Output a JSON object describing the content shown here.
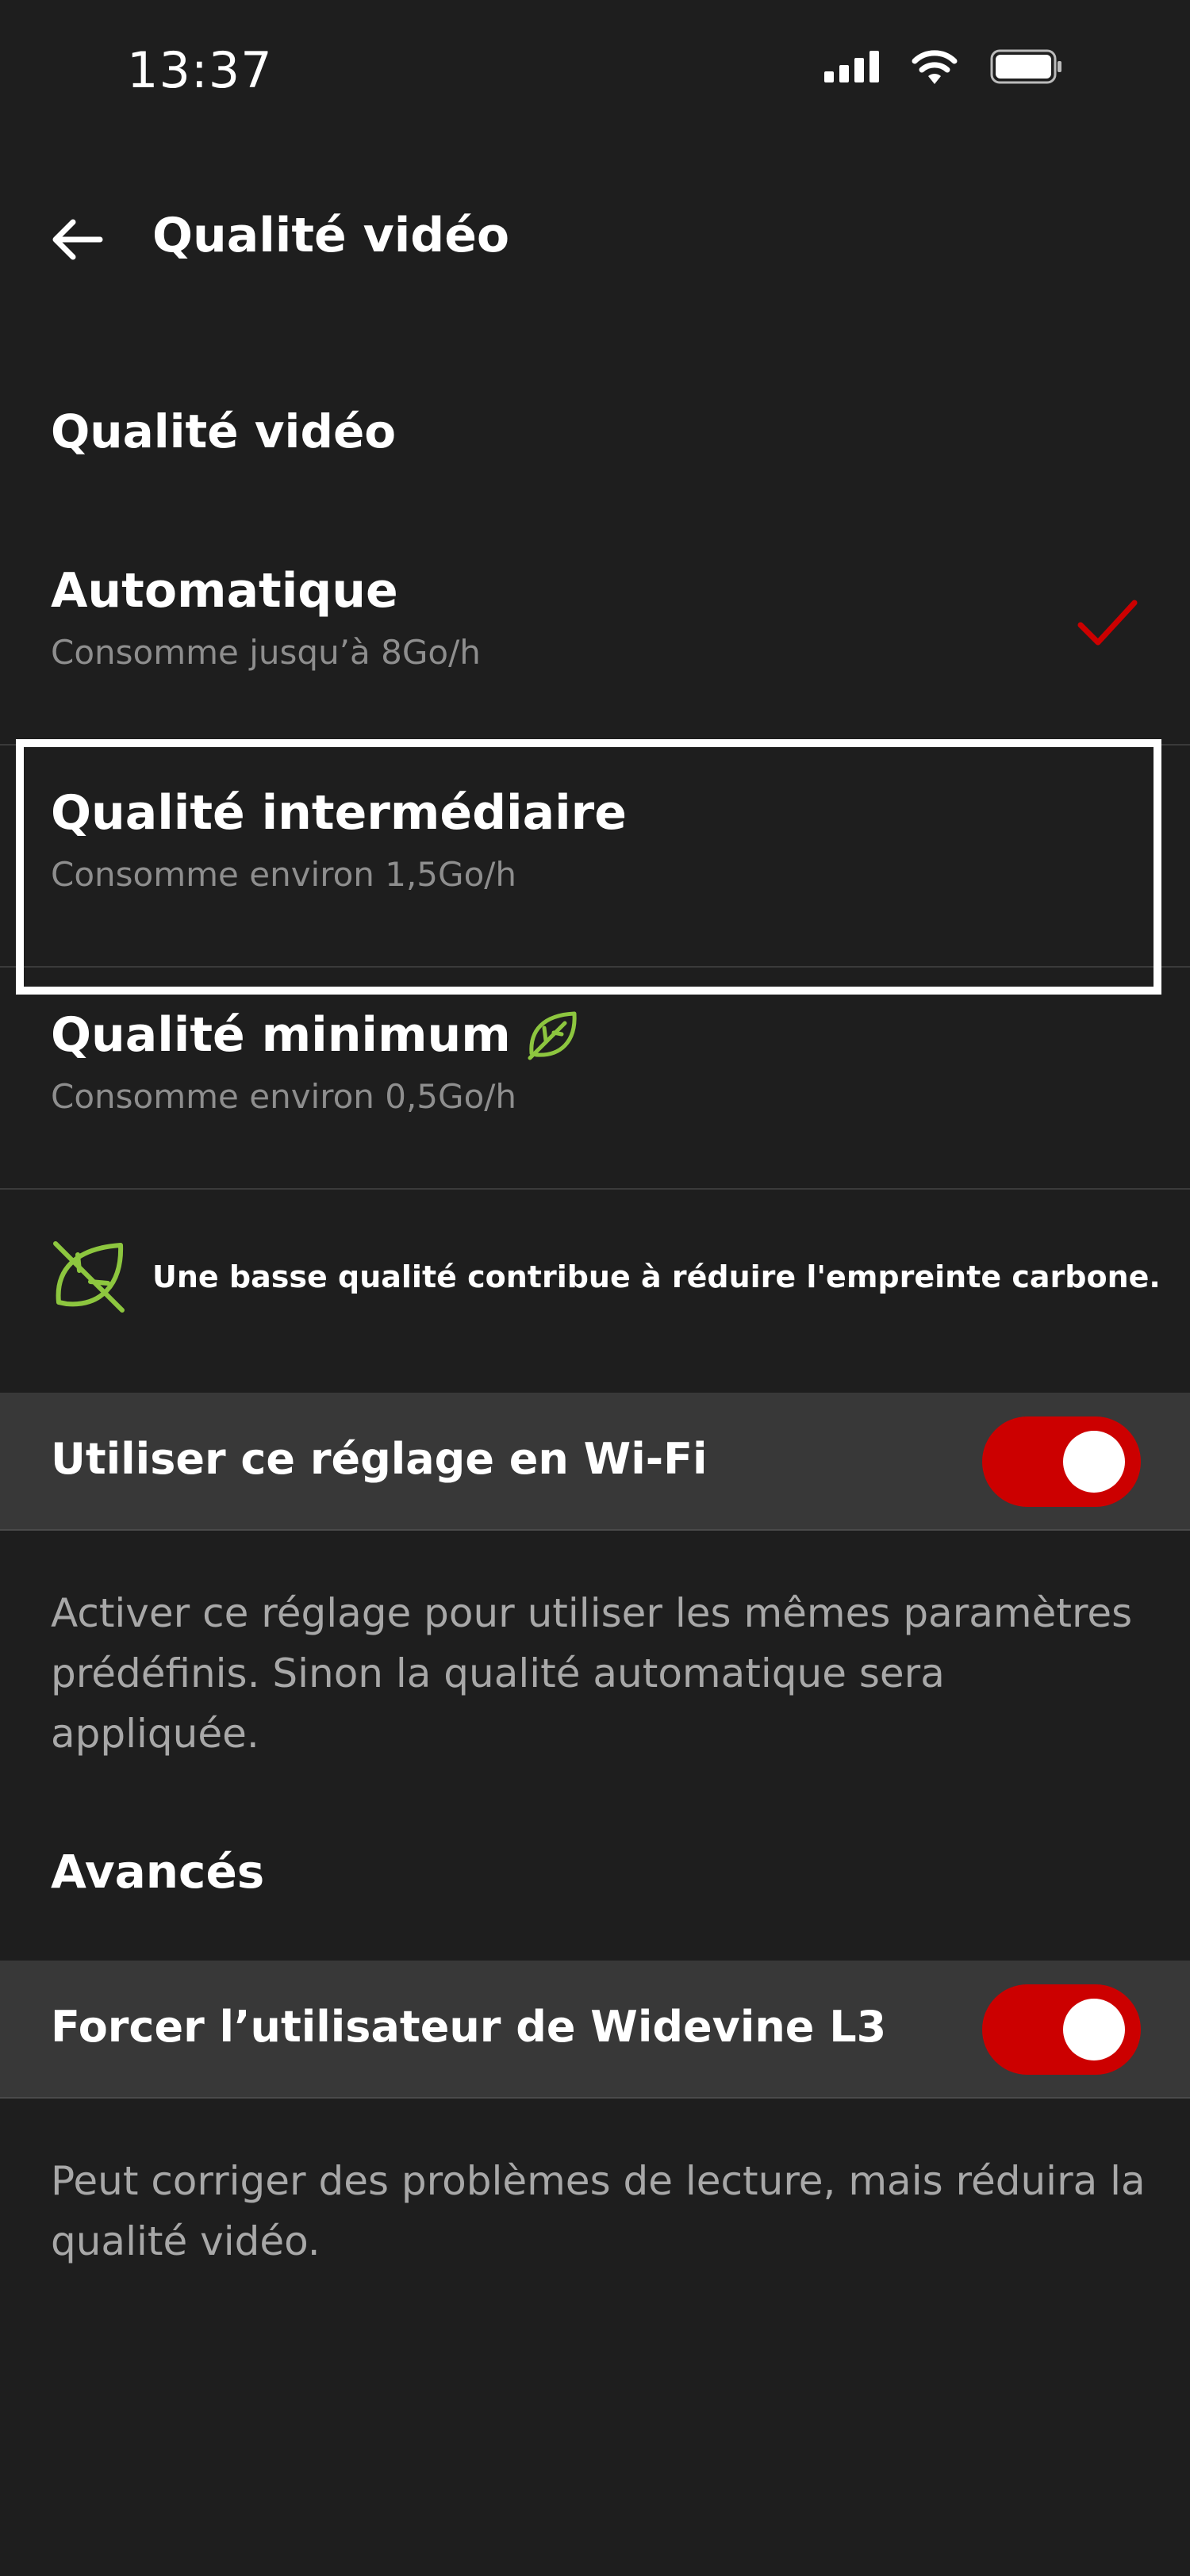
{
  "status_bar": {
    "time": "13:37"
  },
  "header": {
    "title": "Qualité vidéo",
    "back_icon": "arrow-left-icon"
  },
  "quality_section": {
    "title": "Qualité vidéo",
    "options": [
      {
        "title": "Automatique",
        "subtitle": "Consomme jusqu’à 8Go/h",
        "selected": true
      },
      {
        "title": "Qualité intermédiaire",
        "subtitle": "Consomme environ 1,5Go/h",
        "selected": false
      },
      {
        "title": "Qualité minimum",
        "subtitle": "Consomme environ 0,5Go/h",
        "selected": false
      }
    ]
  },
  "eco_note": {
    "text": "Une basse qualité contribue à réduire l'empreinte carbone.",
    "icon": "leaf-icon"
  },
  "wifi_setting": {
    "label": "Utiliser ce réglage en Wi-Fi",
    "enabled": true,
    "description": "Activer ce réglage pour utiliser les mêmes paramètres prédéfinis. Sinon la qualité automatique sera appliquée."
  },
  "advanced_section": {
    "title": "Avancés",
    "widevine": {
      "label": "Forcer l’utilisateur de Widevine L3",
      "enabled": true,
      "description": "Peut corriger des problèmes de lecture, mais réduira la qualité vidéo."
    }
  },
  "colors": {
    "accent": "#cc0000",
    "background": "#1e1e1e",
    "row_background": "#383838",
    "leaf": "#8dc63f",
    "subtitle": "#8e8e8e"
  }
}
